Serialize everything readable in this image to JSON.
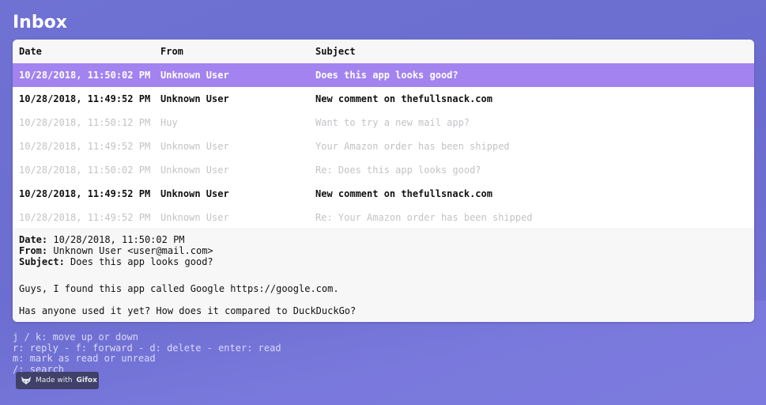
{
  "page": {
    "title": "Inbox"
  },
  "table": {
    "headers": {
      "date": "Date",
      "from": "From",
      "subject": "Subject"
    },
    "rows": [
      {
        "date": "10/28/2018, 11:50:02 PM",
        "from": "Unknown User",
        "subject": "Does this app looks good?",
        "state": "selected"
      },
      {
        "date": "10/28/2018, 11:49:52 PM",
        "from": "Unknown User",
        "subject": "New comment on thefullsnack.com",
        "state": "unread"
      },
      {
        "date": "10/28/2018, 11:50:12 PM",
        "from": "Huy",
        "subject": "Want to try a new mail app?",
        "state": "read"
      },
      {
        "date": "10/28/2018, 11:49:52 PM",
        "from": "Unknown User",
        "subject": "Your Amazon order has been shipped",
        "state": "read"
      },
      {
        "date": "10/28/2018, 11:50:02 PM",
        "from": "Unknown User",
        "subject": "Re: Does this app looks good?",
        "state": "read"
      },
      {
        "date": "10/28/2018, 11:49:52 PM",
        "from": "Unknown User",
        "subject": "New comment on thefullsnack.com",
        "state": "unread"
      },
      {
        "date": "10/28/2018, 11:49:52 PM",
        "from": "Unknown User",
        "subject": "Re: Your Amazon order has been shipped",
        "state": "read"
      }
    ]
  },
  "preview": {
    "date_label": "Date:",
    "date_value": "10/28/2018, 11:50:02 PM",
    "from_label": "From:",
    "from_value": "Unknown User <user@mail.com>",
    "subject_label": "Subject:",
    "subject_value": "Does this app looks good?",
    "body": [
      "Guys, I found this app called Google https://google.com.",
      "Has anyone used it yet? How does it compared to DuckDuckGo?"
    ]
  },
  "shortcuts": [
    "j / k: move up or down",
    "r: reply - f: forward - d: delete - enter: read",
    "m: mark as read or unread",
    "/: search"
  ],
  "badge": {
    "prefix": "Made with",
    "brand": "Gifox",
    "icon": "fox-icon"
  },
  "colors": {
    "background": "#6f72d2",
    "selected_row": "#a283ef",
    "read_text": "#c3c3c7",
    "shortcut_text": "#d9d8f6"
  }
}
